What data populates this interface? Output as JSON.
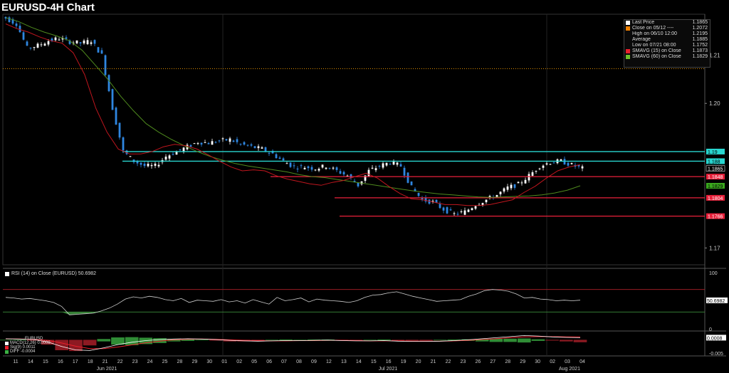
{
  "title": "EURUSD-4H Chart",
  "legend": [
    {
      "label": "Last Price",
      "value": "1.1865",
      "swatch": "#ffffff"
    },
    {
      "label": "Close on 05/12 ----",
      "value": "1.2072",
      "swatch": "#f08000"
    },
    {
      "label": "High on 06/10 12:00",
      "value": "1.2195",
      "swatch": ""
    },
    {
      "label": "Average",
      "value": "1.1885",
      "swatch": ""
    },
    {
      "label": "Low on 07/21 08:00",
      "value": "1.1752",
      "swatch": ""
    },
    {
      "label": "SMAVG (15)  on Close",
      "value": "1.1873",
      "swatch": "#e8202c"
    },
    {
      "label": "SMAVG (60)  on Close",
      "value": "1.1829",
      "swatch": "#6fbf2a"
    }
  ],
  "rsi_label": "RSI (14)  on Close (EURUSD) 50.6982",
  "macd_title": "EURUSD",
  "macd_legend": [
    {
      "label": "MACD(12,26)",
      "value": "0.0008",
      "swatch": "#ffffff"
    },
    {
      "label": "Sig(9)",
      "value": "0.0011",
      "swatch": "#e8202c"
    },
    {
      "label": "DIFF",
      "value": "-0.0004",
      "swatch": "#3cb043"
    }
  ],
  "colors": {
    "candle_up": "#ffffff",
    "candle_down": "#2f86e0",
    "sma15": "#c0161e",
    "sma60": "#4f8a1e",
    "support": "#e8203a",
    "resistance": "#29d6d0",
    "close_line": "#d98a00",
    "rsi_line": "#cfcfcf",
    "rsi_fill": "#3a8a3a"
  },
  "chart_data": {
    "type": "candlestick",
    "title": "EURUSD-4H Chart",
    "y_ticks": [
      "1.21",
      "1.20",
      "1.17"
    ],
    "y_tick_values": [
      1.21,
      1.2,
      1.17
    ],
    "ylim": [
      1.1665,
      1.2185
    ],
    "x_day_labels": [
      "11",
      "14",
      "15",
      "16",
      "17",
      "18",
      "21",
      "22",
      "23",
      "24",
      "25",
      "28",
      "29",
      "30",
      "01",
      "02",
      "05",
      "06",
      "07",
      "08",
      "09",
      "12",
      "13",
      "14",
      "15",
      "16",
      "19",
      "20",
      "21",
      "22",
      "23",
      "26",
      "27",
      "28",
      "29",
      "30",
      "02",
      "03",
      "04"
    ],
    "x_month_labels": [
      "Jun 2021",
      "Jul 2021",
      "Aug 2021"
    ],
    "close_trace": [
      1.2177,
      1.2165,
      1.2115,
      1.212,
      1.213,
      1.2135,
      1.2128,
      1.2125,
      1.213,
      1.21,
      1.199,
      1.19,
      1.188,
      1.187,
      1.187,
      1.189,
      1.19,
      1.191,
      1.192,
      1.1918,
      1.1922,
      1.1925,
      1.1915,
      1.191,
      1.1905,
      1.1895,
      1.188,
      1.1868,
      1.1868,
      1.1865,
      1.187,
      1.186,
      1.185,
      1.183,
      1.186,
      1.187,
      1.1878,
      1.187,
      1.1825,
      1.18,
      1.1795,
      1.178,
      1.177,
      1.1775,
      1.179,
      1.18,
      1.181,
      1.1825,
      1.1832,
      1.185,
      1.187,
      1.1878,
      1.188,
      1.1872,
      1.1865
    ],
    "high": "1.2195",
    "low": "1.1752",
    "last_price": "1.1865",
    "close_0512": "1.2072",
    "average": "1.1885",
    "sma15_last": "1.1873",
    "sma60_last": "1.1829",
    "sma15_trace": [
      1.2165,
      1.2155,
      1.2148,
      1.2138,
      1.213,
      1.2125,
      1.2105,
      1.206,
      1.199,
      1.194,
      1.1905,
      1.1895,
      1.1895,
      1.19,
      1.191,
      1.1915,
      1.1912,
      1.1905,
      1.1893,
      1.188,
      1.1868,
      1.186,
      1.1862,
      1.186,
      1.185,
      1.1843,
      1.1838,
      1.1833,
      1.183,
      1.1836,
      1.184,
      1.1848,
      1.1855,
      1.1845,
      1.1828,
      1.1813,
      1.1802,
      1.18,
      1.1795,
      1.179,
      1.179,
      1.1788,
      1.1788,
      1.179,
      1.1795,
      1.18,
      1.1815,
      1.1828,
      1.1845,
      1.186,
      1.1868,
      1.1873
    ],
    "sma60_trace": [
      1.2178,
      1.217,
      1.2158,
      1.2148,
      1.214,
      1.213,
      1.211,
      1.208,
      1.205,
      1.2015,
      1.1985,
      1.1958,
      1.194,
      1.1925,
      1.1912,
      1.19,
      1.189,
      1.1882,
      1.1875,
      1.187,
      1.1866,
      1.1862,
      1.1858,
      1.1852,
      1.1848,
      1.1846,
      1.1842,
      1.1838,
      1.1834,
      1.183,
      1.1826,
      1.1822,
      1.1818,
      1.1815,
      1.1812,
      1.181,
      1.1808,
      1.1806,
      1.1805,
      1.1806,
      1.1807,
      1.1808,
      1.181,
      1.1814,
      1.182,
      1.1829
    ],
    "horizontal_levels": [
      {
        "label": "1.19",
        "value": 1.19,
        "kind": "resistance"
      },
      {
        "label": "1.188",
        "value": 1.188,
        "kind": "resistance"
      },
      {
        "label": "1.1865",
        "value": 1.1865,
        "kind": "last"
      },
      {
        "label": "1.1848",
        "value": 1.1848,
        "kind": "support"
      },
      {
        "label": "1.1829",
        "value": 1.1829,
        "kind": "sma60"
      },
      {
        "label": "1.1804",
        "value": 1.1804,
        "kind": "support"
      },
      {
        "label": "1.1766",
        "value": 1.1766,
        "kind": "support"
      }
    ],
    "rsi": {
      "label": "RSI (14)  on Close (EURUSD) 50.6982",
      "y_ticks": [
        "100",
        "0"
      ],
      "last": "50.6982",
      "bands": [
        70,
        30
      ],
      "values": [
        56,
        55,
        53,
        54,
        52,
        50,
        47,
        40,
        25,
        26,
        27,
        28,
        32,
        37,
        44,
        53,
        57,
        55,
        58,
        56,
        52,
        50,
        54,
        47,
        51,
        50,
        49,
        52,
        48,
        50,
        46,
        52,
        48,
        44,
        56,
        50,
        52,
        55,
        48,
        53,
        51,
        50,
        49,
        47,
        50,
        56,
        60,
        61,
        64,
        66,
        62,
        58,
        55,
        52,
        49,
        50,
        51,
        52,
        58,
        62,
        68,
        70,
        69,
        67,
        62,
        55,
        56,
        53,
        52,
        50,
        51,
        50,
        51
      ]
    },
    "macd": {
      "title": "EURUSD",
      "y_ticks": [
        "-0.005"
      ],
      "last": "0.0008",
      "macd_last": "0.0008",
      "signal_last": "0.0011",
      "diff_last": "-0.0004",
      "macd_values": [
        0.0004,
        0.0003,
        0.0001,
        -0.0008,
        -0.0025,
        -0.0038,
        -0.004,
        -0.003,
        -0.0018,
        -0.0009,
        -0.0003,
        0.0001,
        0.0003,
        0.0004,
        0.0003,
        0.0001,
        -0.0002,
        -0.0004,
        -0.0005,
        -0.0004,
        -0.0003,
        -0.0003,
        -0.0002,
        -0.0001,
        -0.0003,
        -0.0004,
        -0.0004,
        -0.0003,
        -0.0005,
        -0.0006,
        -0.0006,
        -0.0005,
        -0.0003,
        0.0,
        0.0004,
        0.0008,
        0.0012,
        0.0016,
        0.0014,
        0.0011,
        0.0009,
        0.0008
      ],
      "signal_values": [
        0.0004,
        0.0003,
        0.0002,
        -0.0002,
        -0.0012,
        -0.0024,
        -0.0033,
        -0.0033,
        -0.0027,
        -0.0019,
        -0.0011,
        -0.0005,
        0.0,
        0.0002,
        0.0003,
        0.0002,
        0.0,
        -0.0002,
        -0.0003,
        -0.0004,
        -0.0004,
        -0.0003,
        -0.0003,
        -0.0002,
        -0.0002,
        -0.0003,
        -0.0004,
        -0.0004,
        -0.0004,
        -0.0005,
        -0.0005,
        -0.0005,
        -0.0004,
        -0.0002,
        0.0001,
        0.0004,
        0.0008,
        0.0011,
        0.0012,
        0.0012,
        0.0011,
        0.0011
      ]
    }
  }
}
